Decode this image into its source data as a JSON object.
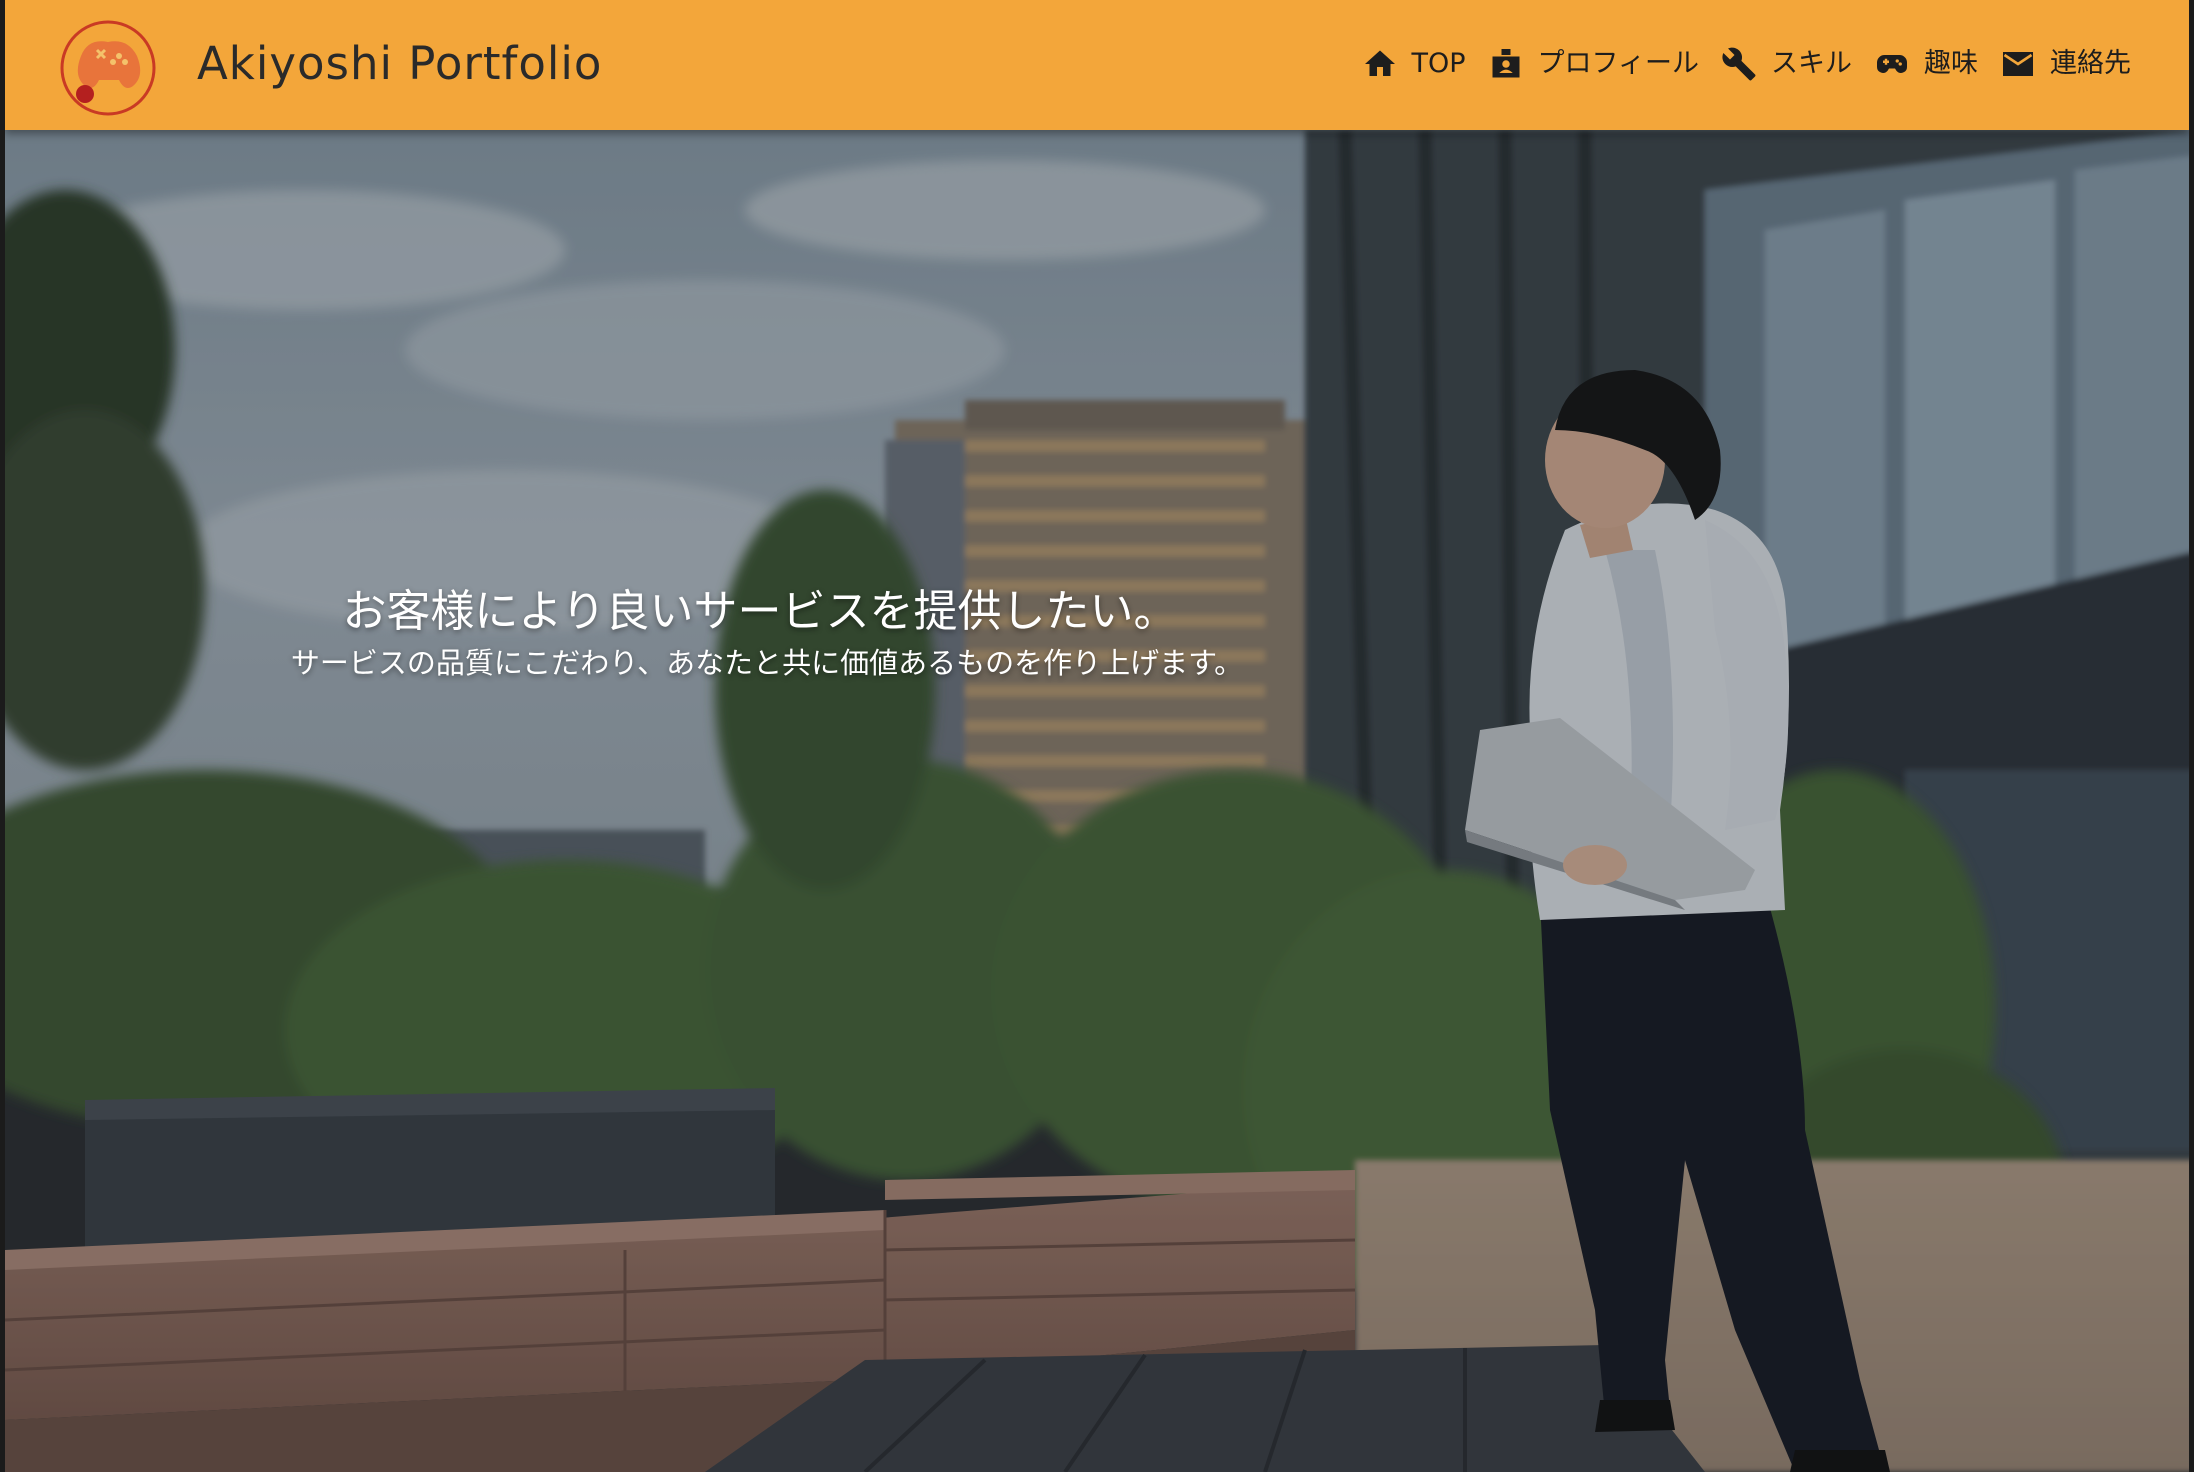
{
  "header": {
    "brand": "Akiyoshi Portfolio",
    "logo_icon": "game-controller-logo",
    "accent_color": "#f3a63a"
  },
  "nav": {
    "items": [
      {
        "label": "TOP",
        "icon": "home-icon"
      },
      {
        "label": "プロフィール",
        "icon": "id-badge-icon"
      },
      {
        "label": "スキル",
        "icon": "wrench-icon"
      },
      {
        "label": "趣味",
        "icon": "gamepad-icon"
      },
      {
        "label": "連絡先",
        "icon": "mail-icon"
      }
    ]
  },
  "hero": {
    "title": "お客様により良いサービスを提供したい。",
    "subtitle": "サービスの品質にこだわり、あなたと共に価値あるものを作り上げます。",
    "background": "photo of man with laptop standing on rooftop garden near buildings"
  }
}
